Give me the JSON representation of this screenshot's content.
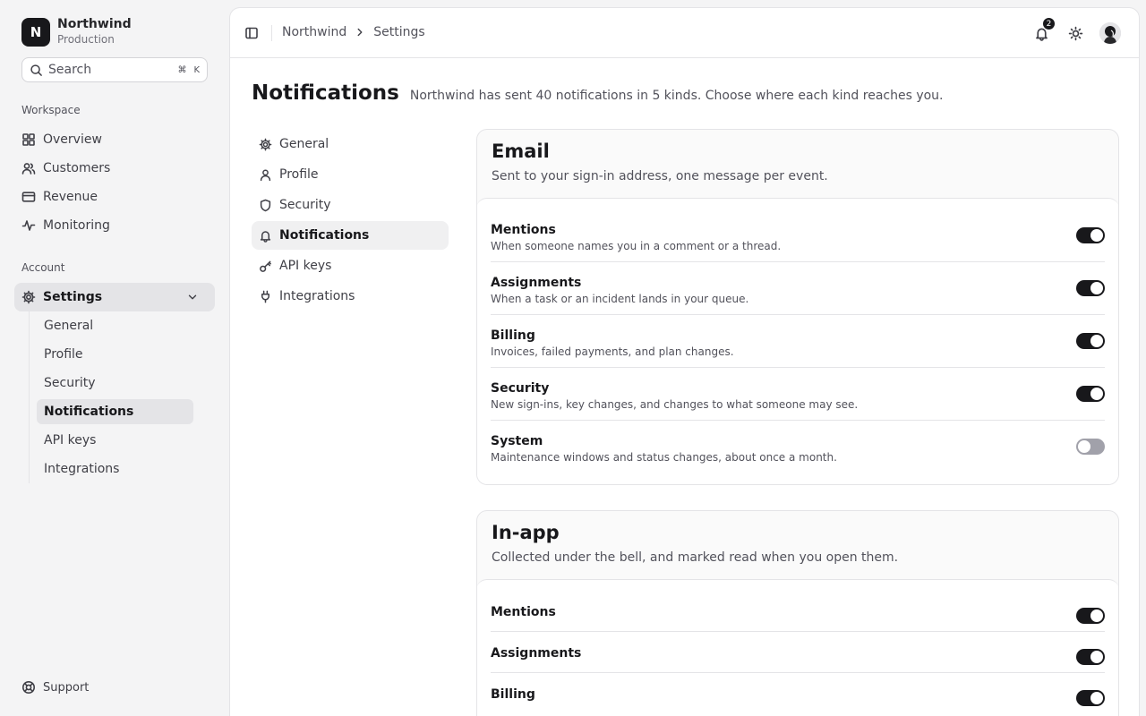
{
  "org": {
    "initial": "N",
    "name": "Northwind",
    "environment": "Production"
  },
  "search": {
    "placeholder": "Search",
    "shortcut_cmd": "⌘",
    "shortcut_key": "K"
  },
  "sidebar": {
    "workspace_label": "Workspace",
    "workspace_items": [
      {
        "label": "Overview",
        "icon": "dashboard-icon"
      },
      {
        "label": "Customers",
        "icon": "users-icon"
      },
      {
        "label": "Revenue",
        "icon": "credit-card-icon"
      },
      {
        "label": "Monitoring",
        "icon": "activity-icon"
      }
    ],
    "account_label": "Account",
    "settings": {
      "label": "Settings",
      "icon": "gear-icon",
      "expanded": true
    },
    "settings_children": [
      "General",
      "Profile",
      "Security",
      "Notifications",
      "API keys",
      "Integrations"
    ],
    "active_child": "Notifications",
    "support_label": "Support"
  },
  "breadcrumb": [
    "Northwind",
    "Settings"
  ],
  "topbar": {
    "notification_count": "2"
  },
  "page": {
    "title": "Notifications",
    "description": "Northwind has sent 40 notifications in 5 kinds. Choose where each kind reaches you."
  },
  "subnav": [
    {
      "label": "General",
      "icon": "gear-icon"
    },
    {
      "label": "Profile",
      "icon": "user-icon"
    },
    {
      "label": "Security",
      "icon": "shield-icon"
    },
    {
      "label": "Notifications",
      "icon": "bell-icon",
      "active": true
    },
    {
      "label": "API keys",
      "icon": "key-icon"
    },
    {
      "label": "Integrations",
      "icon": "plug-icon"
    }
  ],
  "cards": [
    {
      "title": "Email",
      "description": "Sent to your sign-in address, one message per event.",
      "rows": [
        {
          "title": "Mentions",
          "description": "When someone names you in a comment or a thread.",
          "enabled": true
        },
        {
          "title": "Assignments",
          "description": "When a task or an incident lands in your queue.",
          "enabled": true
        },
        {
          "title": "Billing",
          "description": "Invoices, failed payments, and plan changes.",
          "enabled": true
        },
        {
          "title": "Security",
          "description": "New sign-ins, key changes, and changes to what someone may see.",
          "enabled": true
        },
        {
          "title": "System",
          "description": "Maintenance windows and status changes, about once a month.",
          "enabled": false
        }
      ]
    },
    {
      "title": "In-app",
      "description": "Collected under the bell, and marked read when you open them.",
      "rows": [
        {
          "title": "Mentions",
          "enabled": true
        },
        {
          "title": "Assignments",
          "enabled": true
        },
        {
          "title": "Billing",
          "enabled": true
        }
      ]
    }
  ]
}
